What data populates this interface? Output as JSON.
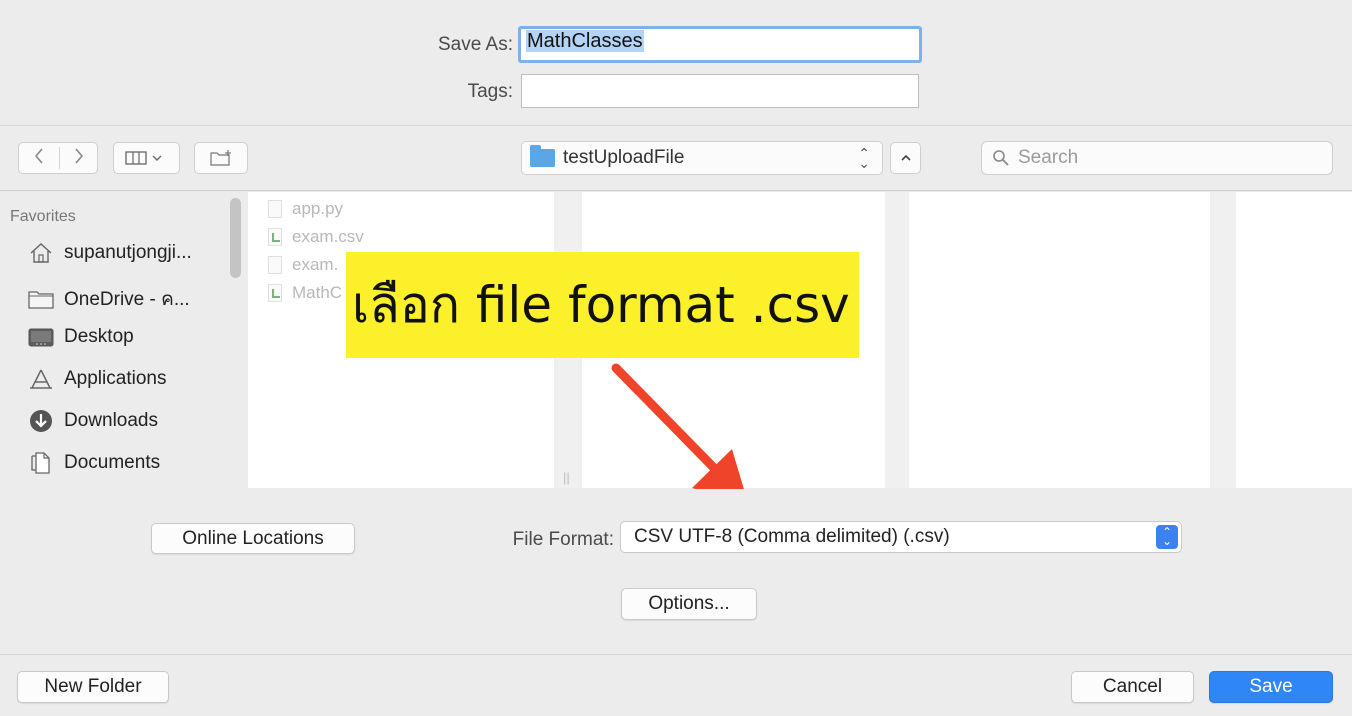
{
  "header": {
    "save_as_label": "Save As:",
    "save_as_value": "MathClasses",
    "tags_label": "Tags:",
    "tags_value": ""
  },
  "toolbar": {
    "back_icon": "chevron-left-icon",
    "forward_icon": "chevron-right-icon",
    "view_icon": "column-view-icon",
    "new_folder_icon": "new-folder-icon",
    "path_folder": "testUploadFile",
    "search_placeholder": "Search"
  },
  "sidebar": {
    "heading": "Favorites",
    "items": [
      {
        "label": "supanutjongji...",
        "icon": "home-icon"
      },
      {
        "label": "OneDrive - ค...",
        "icon": "folder-icon"
      },
      {
        "label": "Desktop",
        "icon": "desktop-icon"
      },
      {
        "label": "Applications",
        "icon": "applications-icon"
      },
      {
        "label": "Downloads",
        "icon": "downloads-icon"
      },
      {
        "label": "Documents",
        "icon": "documents-icon"
      }
    ]
  },
  "files": [
    {
      "name": "app.py",
      "type": "generic"
    },
    {
      "name": "exam.csv",
      "type": "csv"
    },
    {
      "name": "exam.",
      "type": "xlsx"
    },
    {
      "name": "MathC",
      "type": "csv"
    }
  ],
  "annotation": {
    "text": "เลือก file format .csv",
    "highlight_color": "#fbf029",
    "arrow_color": "#f0442a"
  },
  "options": {
    "online_locations_label": "Online Locations",
    "file_format_label": "File Format:",
    "file_format_value": "CSV UTF-8 (Comma delimited) (.csv)",
    "options_button_label": "Options..."
  },
  "footer": {
    "new_folder_label": "New Folder",
    "cancel_label": "Cancel",
    "save_label": "Save"
  },
  "colors": {
    "accent": "#2f86f6",
    "folder": "#5aa6e6",
    "focus_ring": "#7fb0ec"
  }
}
